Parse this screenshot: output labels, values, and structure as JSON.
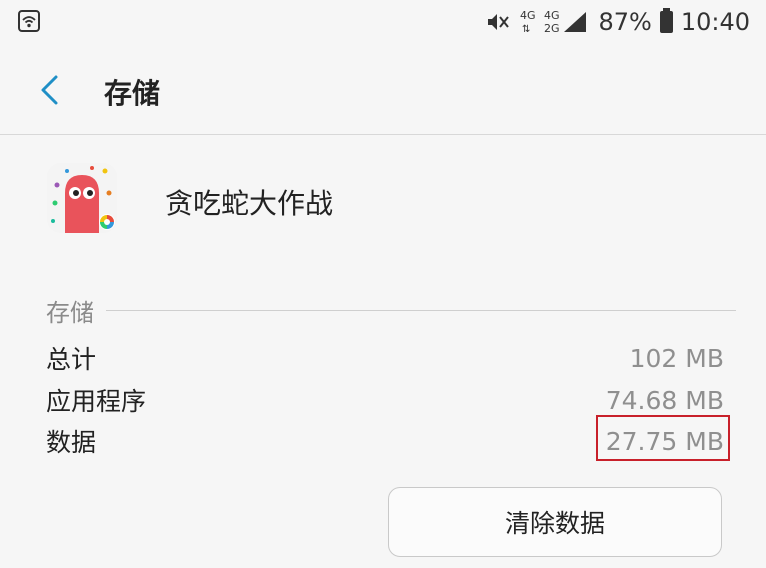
{
  "status_bar": {
    "network_top": "4G",
    "network_bottom": "2G",
    "network_left_top": "4G",
    "battery": "87%",
    "time": "10:40"
  },
  "header": {
    "title": "存储"
  },
  "app": {
    "name": "贪吃蛇大作战"
  },
  "storage": {
    "section_title": "存储",
    "rows": [
      {
        "label": "总计",
        "value": "102 MB"
      },
      {
        "label": "应用程序",
        "value": "74.68 MB"
      },
      {
        "label": "数据",
        "value": "27.75 MB"
      }
    ]
  },
  "actions": {
    "clear_data": "清除数据"
  },
  "colors": {
    "accent": "#1f8fc6",
    "highlight": "#c8202a",
    "app_icon_body": "#e9535b"
  }
}
